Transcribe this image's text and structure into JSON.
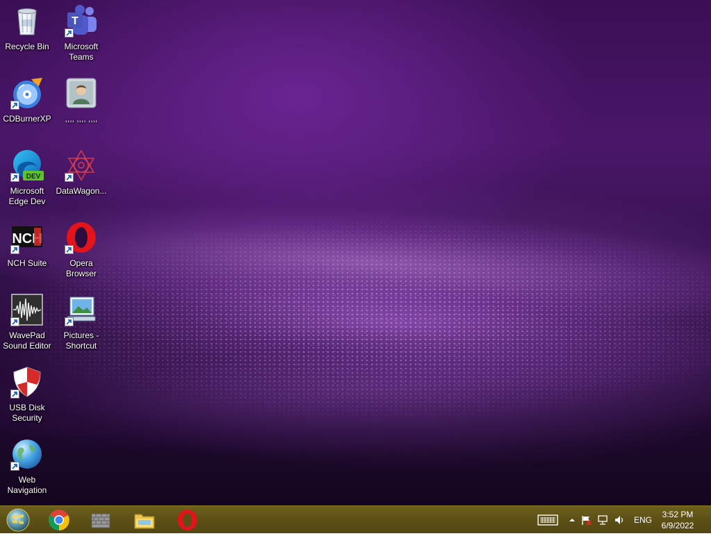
{
  "desktop": {
    "icons": [
      {
        "label": "Recycle Bin",
        "icon": "recycle-bin-icon"
      },
      {
        "label": "Microsoft Teams",
        "icon": "teams-icon"
      },
      {
        "label": "CDBurnerXP",
        "icon": "cdburner-icon"
      },
      {
        "label": ",,,, ,,,, ,,,,",
        "icon": "user-contact-icon"
      },
      {
        "label": "Microsoft Edge Dev",
        "icon": "edge-dev-icon"
      },
      {
        "label": "DataWagon...",
        "icon": "datawagon-icon"
      },
      {
        "label": "NCH Suite",
        "icon": "nch-suite-icon"
      },
      {
        "label": "Opera Browser",
        "icon": "opera-icon"
      },
      {
        "label": "WavePad Sound Editor",
        "icon": "wavepad-icon"
      },
      {
        "label": "Pictures - Shortcut",
        "icon": "pictures-shortcut-icon"
      },
      {
        "label": "USB Disk Security",
        "icon": "usb-disk-security-icon"
      },
      {
        "label": "Web Navigation",
        "icon": "web-navigation-icon"
      }
    ],
    "edge_badge": "DEV",
    "teams_letter": "T",
    "nch_text": "NCH"
  },
  "taskbar": {
    "pinned": [
      {
        "name": "chrome",
        "icon": "chrome-icon"
      },
      {
        "name": "app",
        "icon": "app-grid-icon"
      },
      {
        "name": "file-explorer",
        "icon": "folder-icon"
      },
      {
        "name": "opera",
        "icon": "opera-icon"
      }
    ],
    "tray": {
      "language": "ENG",
      "time": "3:52 PM",
      "date": "6/9/2022"
    }
  },
  "colors": {
    "taskbar": "#5d5016",
    "wallpaper_dark": "#2a0c3e",
    "wallpaper_accent": "#6a2491"
  }
}
